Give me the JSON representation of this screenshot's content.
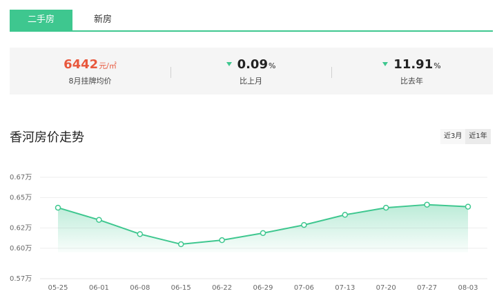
{
  "tabs": [
    {
      "label": "二手房",
      "active": true
    },
    {
      "label": "新房",
      "active": false
    }
  ],
  "stats": [
    {
      "value": "6442",
      "unit": "元/㎡",
      "label": "8月挂牌均价",
      "trend": ""
    },
    {
      "value": "0.09",
      "unit": "%",
      "label": "比上月",
      "trend": "down"
    },
    {
      "value": "11.91",
      "unit": "%",
      "label": "比去年",
      "trend": "down"
    }
  ],
  "section": {
    "title": "香河房价走势",
    "ranges": [
      {
        "label": "近3月",
        "active": false
      },
      {
        "label": "近1年",
        "active": true
      }
    ]
  },
  "colors": {
    "accent": "#3ec78f",
    "price": "#e8583d"
  },
  "chart_data": {
    "type": "area",
    "x": [
      "05-25",
      "06-01",
      "06-08",
      "06-15",
      "06-22",
      "06-29",
      "07-06",
      "07-13",
      "07-20",
      "07-27",
      "08-03"
    ],
    "values": [
      0.64,
      0.628,
      0.614,
      0.604,
      0.608,
      0.615,
      0.623,
      0.633,
      0.64,
      0.643,
      0.641
    ],
    "yticks": [
      0.57,
      0.6,
      0.62,
      0.65,
      0.67
    ],
    "ytick_labels": [
      "0.57万",
      "0.60万",
      "0.62万",
      "0.65万",
      "0.67万"
    ],
    "ylim": [
      0.57,
      0.67
    ],
    "title": "",
    "xlabel": "",
    "ylabel": "",
    "grid": true
  }
}
